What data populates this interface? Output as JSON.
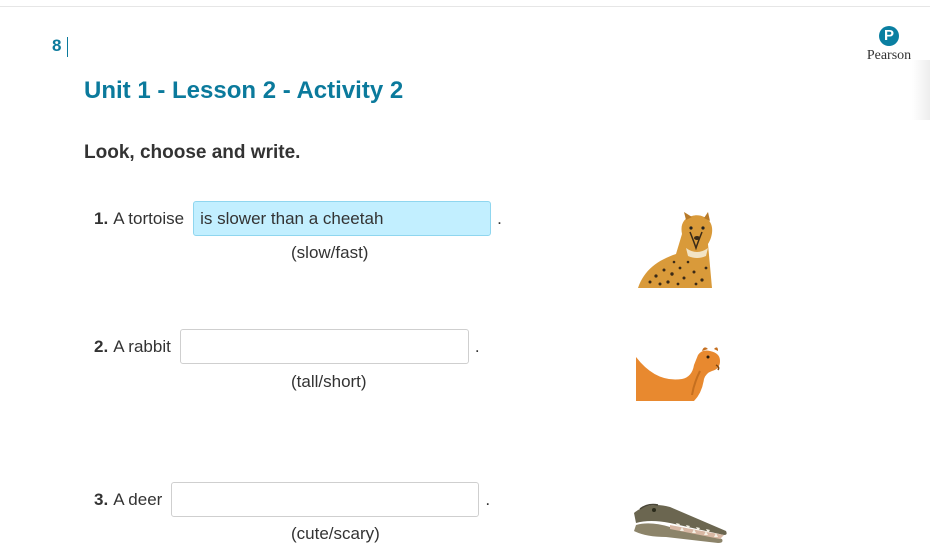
{
  "header": {
    "page_number": "8",
    "logo_text": "Pearson",
    "logo_mark": "P"
  },
  "title": "Unit 1 - Lesson 2 - Activity 2",
  "instruction": "Look, choose and write.",
  "questions": [
    {
      "number": "1.",
      "subject": "A tortoise",
      "answer": "is slower than a cheetah",
      "period": ".",
      "hint": "(slow/fast)",
      "picture": "cheetah-image"
    },
    {
      "number": "2.",
      "subject": "A rabbit",
      "answer": "",
      "period": ".",
      "hint": "(tall/short)",
      "picture": "camel-image"
    },
    {
      "number": "3.",
      "subject": "A deer",
      "answer": "",
      "period": ".",
      "hint": "(cute/scary)",
      "picture": "crocodile-image"
    }
  ],
  "colors": {
    "accent": "#0b7a9c",
    "filled_answer": "#c2efff"
  }
}
